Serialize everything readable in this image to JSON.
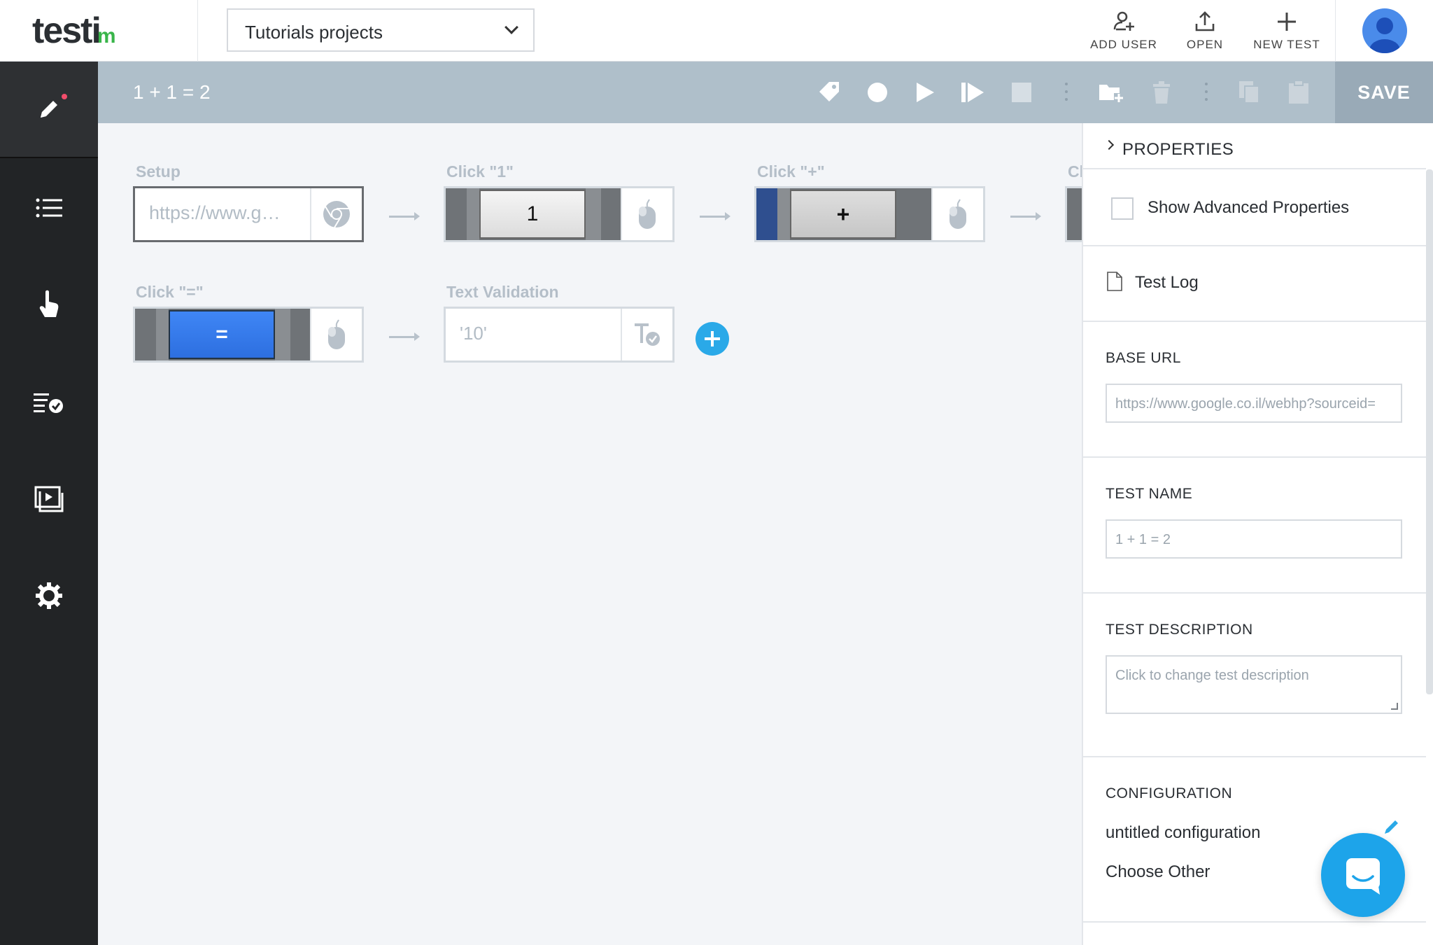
{
  "header": {
    "logo_text": "testi",
    "logo_mark": "m",
    "project_name": "Tutorials projects",
    "actions": [
      {
        "label": "ADD USER",
        "icon": "add-user-icon"
      },
      {
        "label": "OPEN",
        "icon": "upload-icon"
      },
      {
        "label": "NEW TEST",
        "icon": "plus-icon"
      }
    ],
    "avatar_icon": "user-avatar-icon"
  },
  "sidebar": {
    "items": [
      {
        "name": "edit",
        "icon": "pencil-icon",
        "active": true
      },
      {
        "name": "tests-list",
        "icon": "list-icon"
      },
      {
        "name": "steps",
        "icon": "hand-pointer-icon"
      },
      {
        "name": "test-runs",
        "icon": "checklist-icon"
      },
      {
        "name": "executions",
        "icon": "play-window-icon"
      },
      {
        "name": "settings",
        "icon": "gear-icon"
      }
    ]
  },
  "toolbar": {
    "test_title": "1 + 1 = 2",
    "save_label": "SAVE",
    "buttons": [
      "tag-icon",
      "record-icon",
      "play-icon",
      "step-play-icon",
      "stop-icon",
      "folder-add-icon",
      "trash-icon",
      "copy-icon",
      "paste-icon"
    ]
  },
  "steps": [
    {
      "label": "Setup",
      "type": "setup",
      "thumb_text": "https://www.g…",
      "icon": "chrome-icon"
    },
    {
      "label": "Click \"1\"",
      "type": "click",
      "thumb_text": "1",
      "icon": "mouse-icon"
    },
    {
      "label": "Click \"+\"",
      "type": "click",
      "thumb_text": "+",
      "icon": "mouse-icon"
    },
    {
      "label": "Cl",
      "type": "click",
      "thumb_text": "",
      "icon": "mouse-icon"
    },
    {
      "label": "Click \"=\"",
      "type": "click",
      "thumb_text": "=",
      "icon": "mouse-icon"
    },
    {
      "label": "Text Validation",
      "type": "validation",
      "thumb_text": "'10'",
      "icon": "text-check-icon"
    }
  ],
  "properties": {
    "title": "PROPERTIES",
    "show_advanced_label": "Show Advanced Properties",
    "show_advanced_checked": false,
    "test_log_label": "Test Log",
    "base_url_title": "BASE URL",
    "base_url_value": "https://www.google.co.il/webhp?sourceid=",
    "test_name_title": "TEST NAME",
    "test_name_value": "1 + 1 = 2",
    "test_description_title": "TEST DESCRIPTION",
    "test_description_placeholder": "Click to change test description",
    "configuration_title": "CONFIGURATION",
    "configuration_value": "untitled configuration",
    "configuration_choose": "Choose Other"
  },
  "colors": {
    "accent": "#2aa9e8",
    "sidebar_bg": "#222426",
    "toolbar_bg": "#afbfca",
    "save_bg": "#99aab7",
    "logo_check": "#39b54a",
    "notification_dot": "#f24d6b"
  }
}
